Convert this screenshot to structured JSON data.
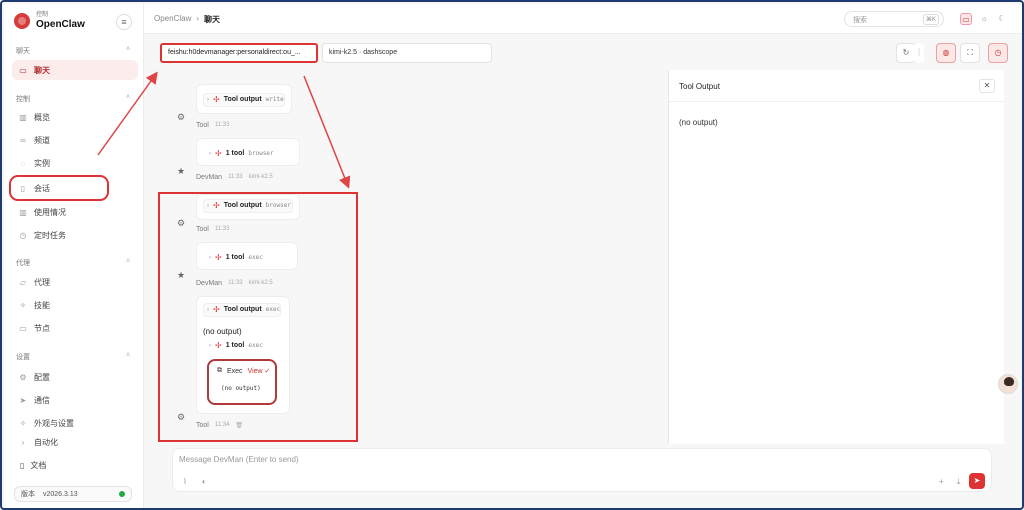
{
  "brand": {
    "sub": "控制",
    "name": "OpenClaw"
  },
  "sidebar": {
    "sections": [
      {
        "label": "聊天",
        "items": [
          {
            "label": "聊天",
            "icon": "chat-bubble-icon"
          }
        ]
      },
      {
        "label": "控制",
        "items": [
          {
            "label": "概览",
            "icon": "bar-chart-icon"
          },
          {
            "label": "频道",
            "icon": "link-icon"
          },
          {
            "label": "实例",
            "icon": "signal-icon"
          },
          {
            "label": "会话",
            "icon": "document-icon"
          },
          {
            "label": "使用情况",
            "icon": "bar-chart-icon"
          },
          {
            "label": "定时任务",
            "icon": "clock-icon"
          }
        ]
      },
      {
        "label": "代理",
        "items": [
          {
            "label": "代理",
            "icon": "folder-icon"
          },
          {
            "label": "技能",
            "icon": "sparkle-icon"
          },
          {
            "label": "节点",
            "icon": "monitor-icon"
          }
        ]
      },
      {
        "label": "设置",
        "items": [
          {
            "label": "配置",
            "icon": "gear-icon"
          },
          {
            "label": "通信",
            "icon": "send-icon"
          },
          {
            "label": "外观与设置",
            "icon": "sparkle-icon"
          },
          {
            "label": "自动化",
            "icon": "chevron-right-icon"
          }
        ]
      }
    ],
    "docs_label": "文档",
    "version_label": "版本",
    "version_value": "v2026.3.13"
  },
  "topbar": {
    "crumb_root": "OpenClaw",
    "crumb_sep": "›",
    "crumb_current": "聊天",
    "search_placeholder": "搜索",
    "search_kbd": "⌘K"
  },
  "session": {
    "session_key": "feishu:h0devmanager:personaldirect:ou_...",
    "model": "kimi-k2.5 · dashscope"
  },
  "chat": {
    "messages": [
      {
        "kind": "tool-output",
        "label": "Tool output",
        "arg": "write",
        "sender": "Tool",
        "time": "11:33"
      },
      {
        "kind": "tool-call",
        "label": "1 tool",
        "arg": "browser",
        "sender": "DevMan",
        "time": "11:33",
        "model": "kimi-k2.5"
      },
      {
        "kind": "tool-output",
        "label": "Tool output",
        "arg": "browser",
        "sender": "Tool",
        "time": "11:33"
      },
      {
        "kind": "tool-call",
        "label": "1 tool",
        "arg": "exec",
        "sender": "DevMan",
        "time": "11:33",
        "model": "kimi-k2.5"
      },
      {
        "kind": "tool-output-expanded",
        "label": "Tool output",
        "arg": "exec",
        "body": "(no output)",
        "inner_call": {
          "label": "1 tool",
          "arg": "exec"
        },
        "exec_card": {
          "title": "Exec",
          "view": "View ✓",
          "output": "(no output)"
        },
        "sender": "Tool",
        "time": "11:34"
      }
    ]
  },
  "panel": {
    "title": "Tool Output",
    "body": "(no output)"
  },
  "composer": {
    "placeholder": "Message DevMan (Enter to send)"
  },
  "colors": {
    "accent": "#d33333",
    "active_bg": "#fdecec",
    "status_ok": "#22aa44"
  }
}
